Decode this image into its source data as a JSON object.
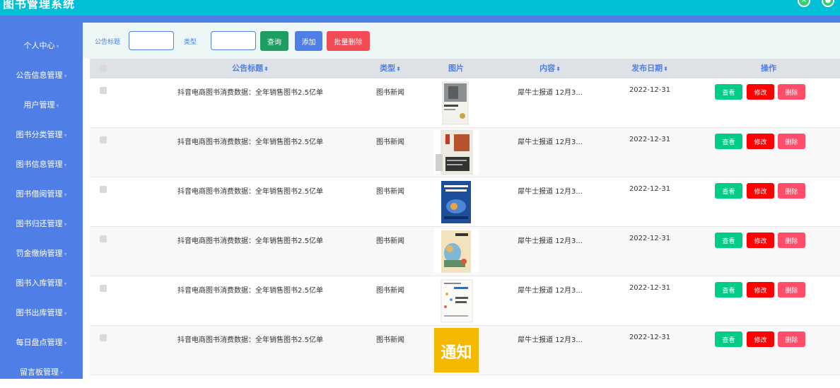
{
  "app": {
    "title": "图书管理系统"
  },
  "header_icons": [
    "close-icon",
    "user-icon"
  ],
  "sidebar": {
    "items": [
      {
        "label": "个人中心"
      },
      {
        "label": "公告信息管理"
      },
      {
        "label": "用户管理"
      },
      {
        "label": "图书分类管理"
      },
      {
        "label": "图书信息管理"
      },
      {
        "label": "图书借阅管理"
      },
      {
        "label": "图书归还管理"
      },
      {
        "label": "罚金缴纳管理"
      },
      {
        "label": "图书入库管理"
      },
      {
        "label": "图书出库管理"
      },
      {
        "label": "每日盘点管理"
      },
      {
        "label": "留言板管理"
      }
    ]
  },
  "search": {
    "title_label": "公告标题",
    "title_value": "",
    "type_label": "类型",
    "type_value": "",
    "query_label": "查询",
    "add_label": "添加",
    "batch_delete_label": "批量删除"
  },
  "table": {
    "headers": {
      "title": "公告标题",
      "type": "类型",
      "image": "图片",
      "content": "内容",
      "date": "发布日期",
      "actions": "操作"
    },
    "rows": [
      {
        "title": "抖音电商图书消费数据：全年销售图书2.5亿单",
        "type": "图书新闻",
        "image_kind": "cover-photo",
        "content": "犀牛士报道 12月3...",
        "date": "2022-12-31"
      },
      {
        "title": "抖音电商图书消费数据：全年销售图书2.5亿单",
        "type": "图书新闻",
        "image_kind": "cover-red-text",
        "content": "犀牛士报道 12月3...",
        "date": "2022-12-31"
      },
      {
        "title": "抖音电商图书消费数据：全年销售图书2.5亿单",
        "type": "图书新闻",
        "image_kind": "cover-blue",
        "content": "犀牛士报道 12月3...",
        "date": "2022-12-31"
      },
      {
        "title": "抖音电商图书消费数据：全年销售图书2.5亿单",
        "type": "图书新闻",
        "image_kind": "cover-illustration",
        "content": "犀牛士报道 12月3...",
        "date": "2022-12-31"
      },
      {
        "title": "抖音电商图书消费数据：全年销售图书2.5亿单",
        "type": "图书新闻",
        "image_kind": "cover-light",
        "content": "犀牛士报道 12月3...",
        "date": "2022-12-31"
      },
      {
        "title": "抖音电商图书消费数据：全年销售图书2.5亿单",
        "type": "图书新闻",
        "image_kind": "notice-yellow",
        "image_text": "通知",
        "content": "犀牛士报道 12月3...",
        "date": "2022-12-31"
      }
    ],
    "view_label": "查看",
    "edit_label": "修改",
    "delete_label": "删除"
  },
  "colors": {
    "topbar": "#00c0d6",
    "sidebar": "#4f7fe6",
    "view_button": "#00cc88",
    "edit_button": "#ff0000",
    "delete_button": "#ff4d6a",
    "query_button": "#1f9e61",
    "add_button": "#4f7fe6",
    "batch_delete_button": "#f24b56"
  }
}
